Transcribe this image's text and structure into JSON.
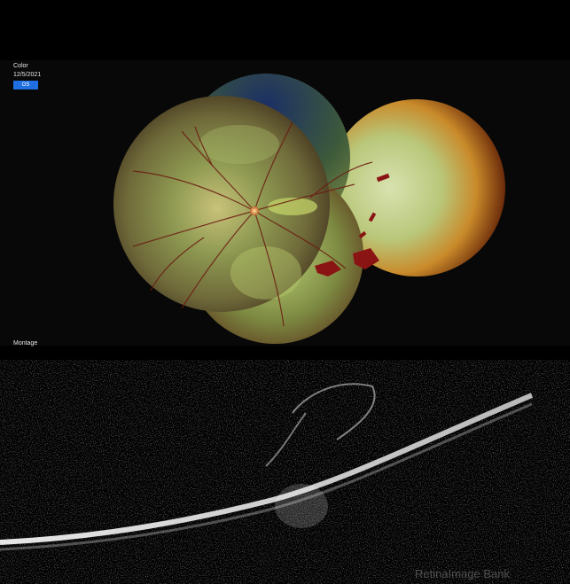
{
  "header": {
    "modality_label": "Color",
    "date_label": "12/5/2021",
    "eye_badge": "OS"
  },
  "footer": {
    "montage_label": "Montage"
  },
  "watermark": {
    "text": "RetinaImage Bank"
  },
  "colors": {
    "badge_blue": "#1f6fe0",
    "background": "#000000",
    "hemorrhage_red": "#8a1414"
  }
}
